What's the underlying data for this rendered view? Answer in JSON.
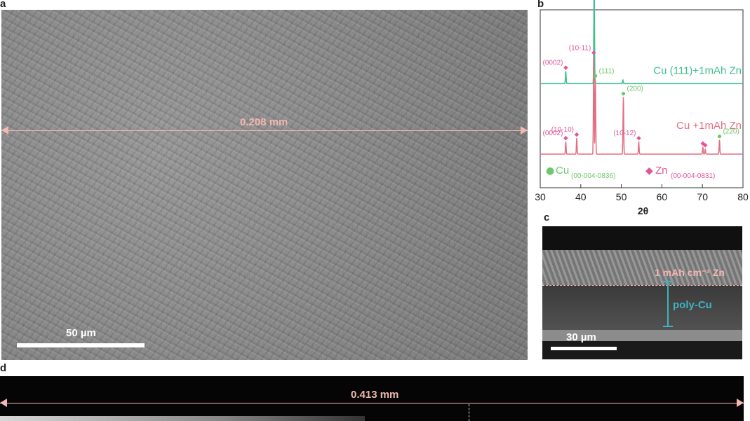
{
  "panel_a": {
    "letter": "a",
    "measurement": "0.208 mm",
    "scale_label": "50 µm"
  },
  "panel_b": {
    "letter": "b",
    "colors": {
      "cu_series": "#3cbf8c",
      "zn_series": "#e36e80",
      "cu_marker": "#6cc86a",
      "zn_marker": "#e0569b"
    },
    "chart_data": {
      "type": "line",
      "xlabel": "2θ",
      "ylabel": "",
      "xlim": [
        30,
        80
      ],
      "xticks": [
        "30",
        "40",
        "50",
        "60",
        "70",
        "80"
      ],
      "series": [
        {
          "name": "Cu (111)+1mAh Zn",
          "baseline_offset": 0.72,
          "peaks": [
            {
              "x": 36.3,
              "h": 0.07,
              "label": "(0002)",
              "phase": "Zn"
            },
            {
              "x": 43.3,
              "h": 0.58,
              "label": "(111)",
              "phase": "Cu"
            },
            {
              "x": 50.4,
              "h": 0.02,
              "label": "",
              "phase": ""
            }
          ]
        },
        {
          "name": "Cu +1mAh Zn",
          "baseline_offset": 0.0,
          "peaks": [
            {
              "x": 36.3,
              "h": 0.07,
              "label": "(0002)",
              "phase": "Zn"
            },
            {
              "x": 39.0,
              "h": 0.09,
              "label": "(10-10)",
              "phase": "Zn"
            },
            {
              "x": 43.2,
              "h": 0.55,
              "label": "(10-11)",
              "phase": "Zn"
            },
            {
              "x": 43.6,
              "h": 0.42,
              "label": "(111)",
              "phase": "Cu"
            },
            {
              "x": 50.5,
              "h": 0.32,
              "label": "(200)",
              "phase": "Cu"
            },
            {
              "x": 54.3,
              "h": 0.07,
              "label": "(10-12)",
              "phase": "Zn"
            },
            {
              "x": 70.1,
              "h": 0.04,
              "label": "",
              "phase": "Zn"
            },
            {
              "x": 70.7,
              "h": 0.03,
              "label": "",
              "phase": "Zn"
            },
            {
              "x": 74.2,
              "h": 0.08,
              "label": "(220)",
              "phase": "Cu"
            }
          ]
        }
      ],
      "legend": [
        {
          "symbol": "●",
          "name": "Cu",
          "ref": "(00-004-0836)"
        },
        {
          "symbol": "◆",
          "name": "Zn",
          "ref": "(00-004-0831)"
        }
      ]
    }
  },
  "panel_c": {
    "letter": "c",
    "zn_label": "1 mAh cm⁻² Zn",
    "cu_label": "poly-Cu",
    "scale_label": "30 µm"
  },
  "panel_d": {
    "letter": "d",
    "measurement": "0.413 mm"
  }
}
